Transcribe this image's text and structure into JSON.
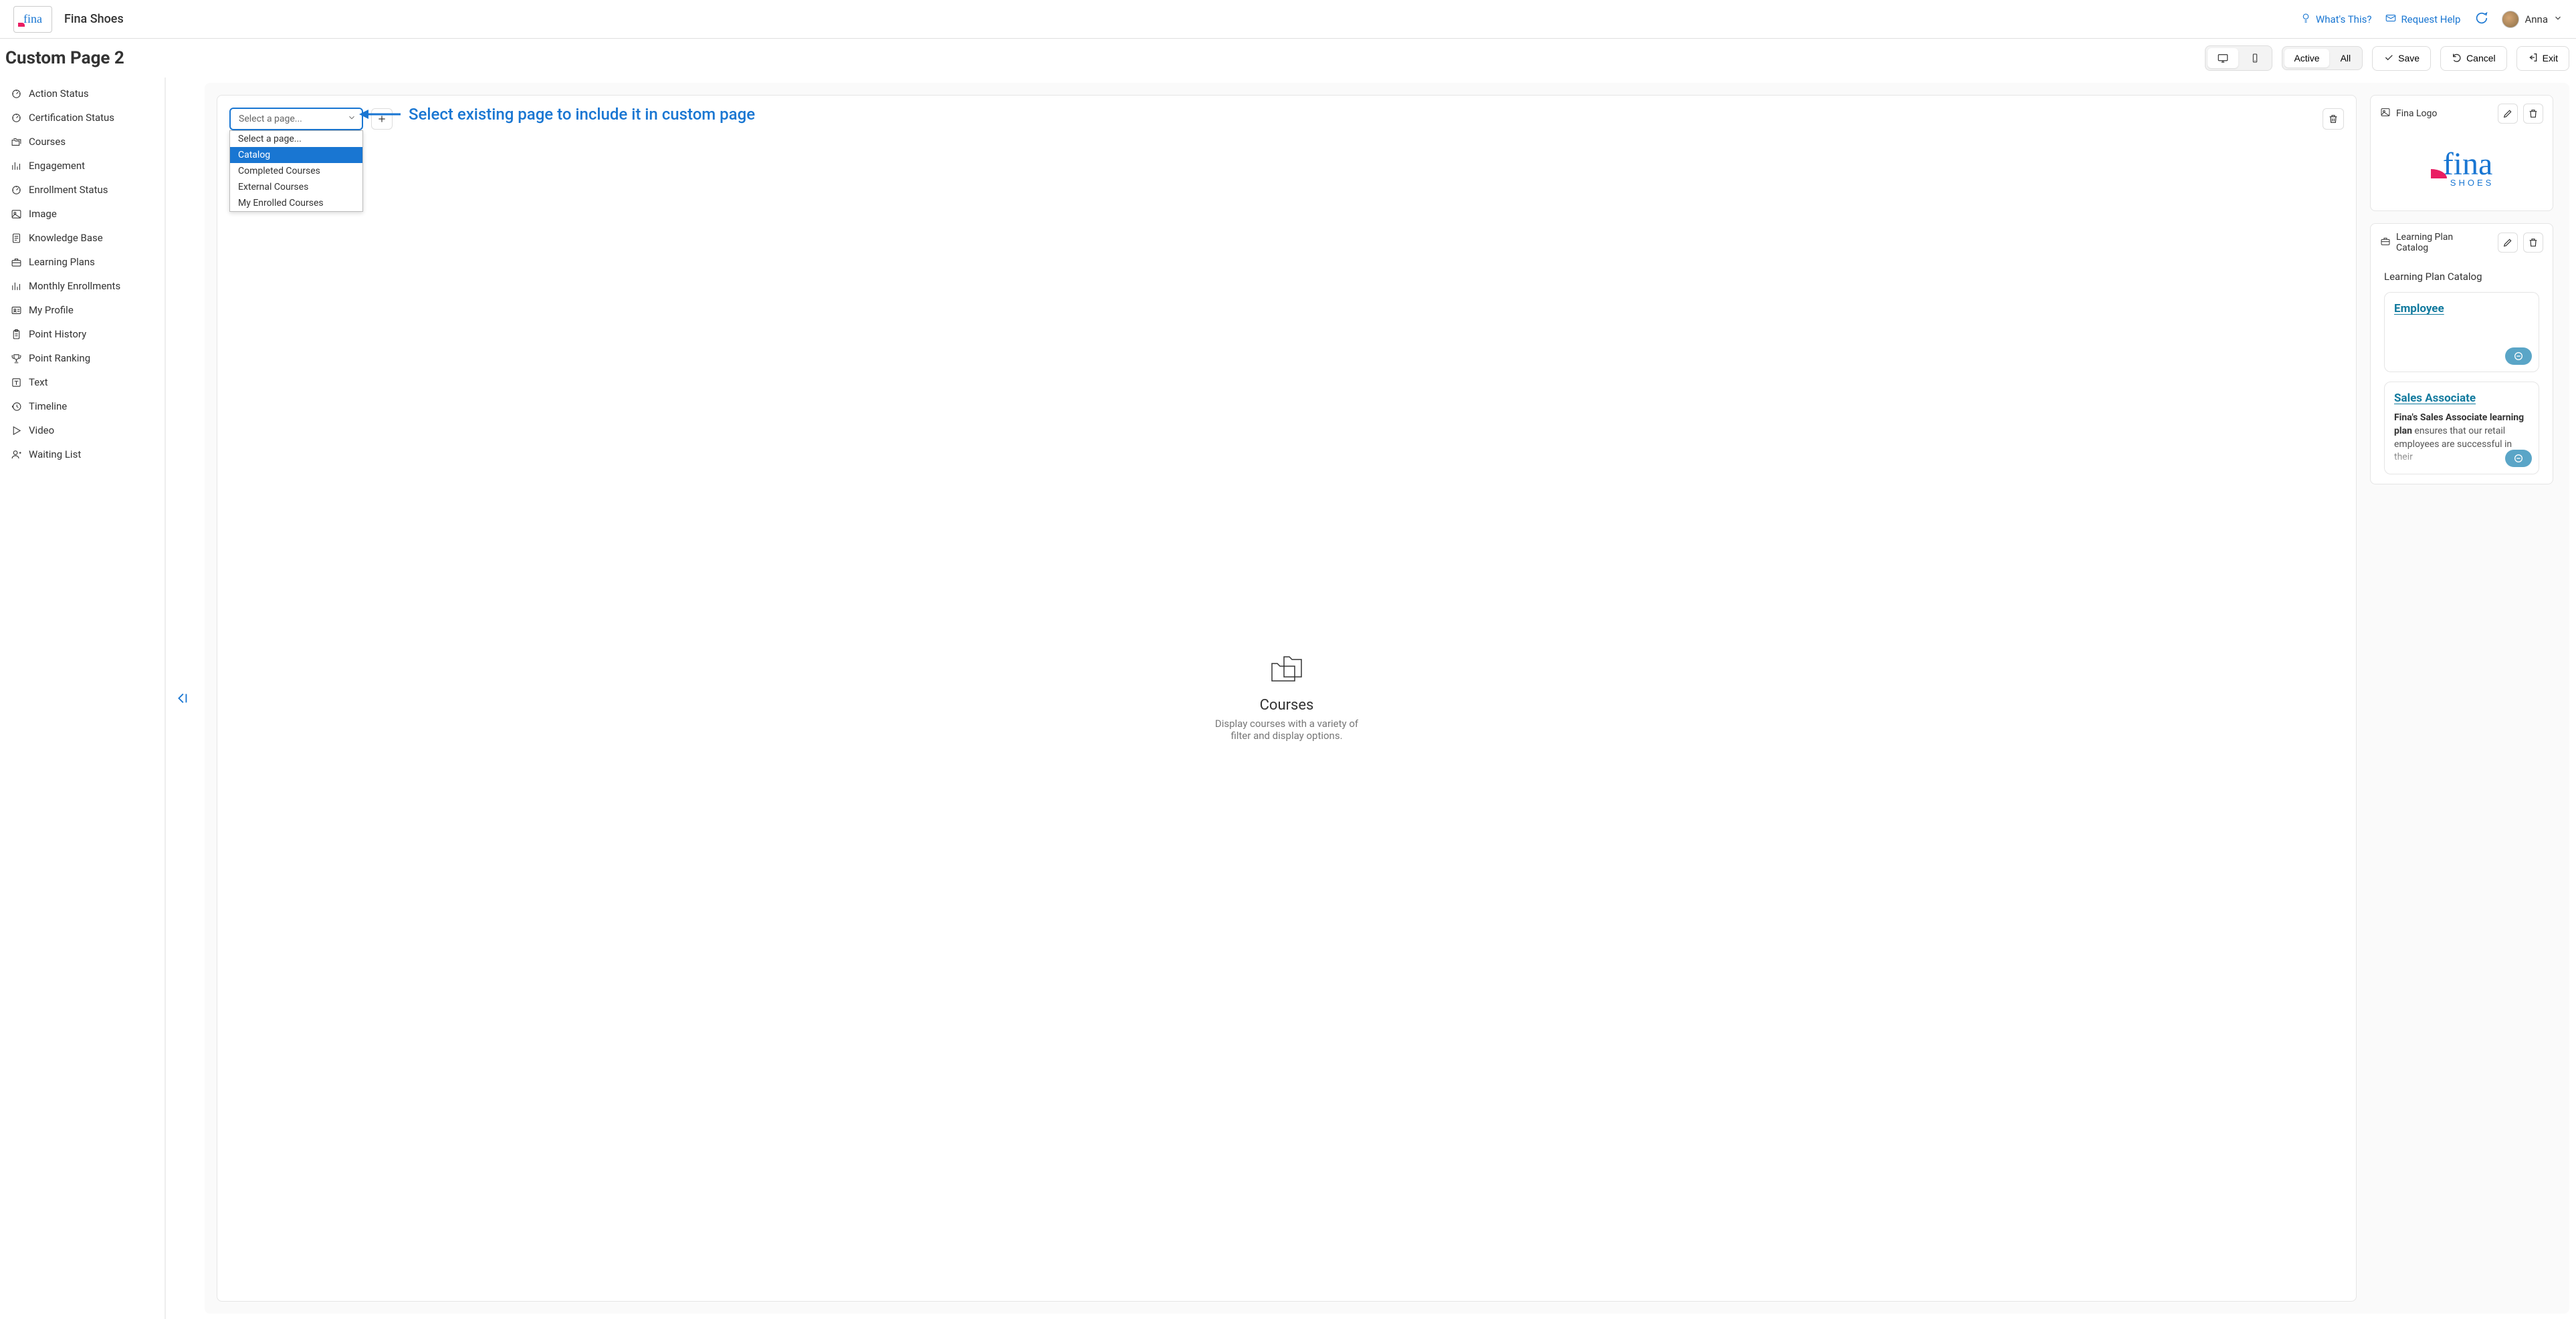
{
  "header": {
    "company": "Fina Shoes",
    "whats_this": "What's This?",
    "request_help": "Request Help",
    "user_name": "Anna"
  },
  "title": "Custom Page 2",
  "toolbar": {
    "active": "Active",
    "all": "All",
    "save": "Save",
    "cancel": "Cancel",
    "exit": "Exit"
  },
  "sidebar": {
    "items": [
      {
        "label": "Action Status",
        "icon": "gauge"
      },
      {
        "label": "Certification Status",
        "icon": "gauge"
      },
      {
        "label": "Courses",
        "icon": "folders"
      },
      {
        "label": "Engagement",
        "icon": "chart"
      },
      {
        "label": "Enrollment Status",
        "icon": "gauge"
      },
      {
        "label": "Image",
        "icon": "image"
      },
      {
        "label": "Knowledge Base",
        "icon": "doc"
      },
      {
        "label": "Learning Plans",
        "icon": "briefcase"
      },
      {
        "label": "Monthly Enrollments",
        "icon": "chart"
      },
      {
        "label": "My Profile",
        "icon": "id-card"
      },
      {
        "label": "Point History",
        "icon": "clipboard"
      },
      {
        "label": "Point Ranking",
        "icon": "trophy"
      },
      {
        "label": "Text",
        "icon": "text-icon"
      },
      {
        "label": "Timeline",
        "icon": "history"
      },
      {
        "label": "Video",
        "icon": "play"
      },
      {
        "label": "Waiting List",
        "icon": "person-plus"
      }
    ]
  },
  "select": {
    "placeholder": "Select a page...",
    "options": [
      "Select a page...",
      "Catalog",
      "Completed Courses",
      "External Courses",
      "My Enrolled Courses"
    ],
    "highlighted_index": 1
  },
  "annotation": {
    "text": "Select existing page to include it in custom page"
  },
  "placeholder": {
    "title": "Courses",
    "desc": "Display courses with a variety of filter and display options."
  },
  "right": {
    "logo_widget_title": "Fina Logo",
    "lp_widget_title": "Learning Plan Catalog",
    "lp_body_title": "Learning Plan Catalog",
    "cards": [
      {
        "title": "Employee",
        "desc_bold": "",
        "desc": ""
      },
      {
        "title": "Sales Associate",
        "desc_bold": "Fina's Sales Associate learning plan",
        "desc": " ensures that our retail employees are successful in their"
      }
    ]
  }
}
